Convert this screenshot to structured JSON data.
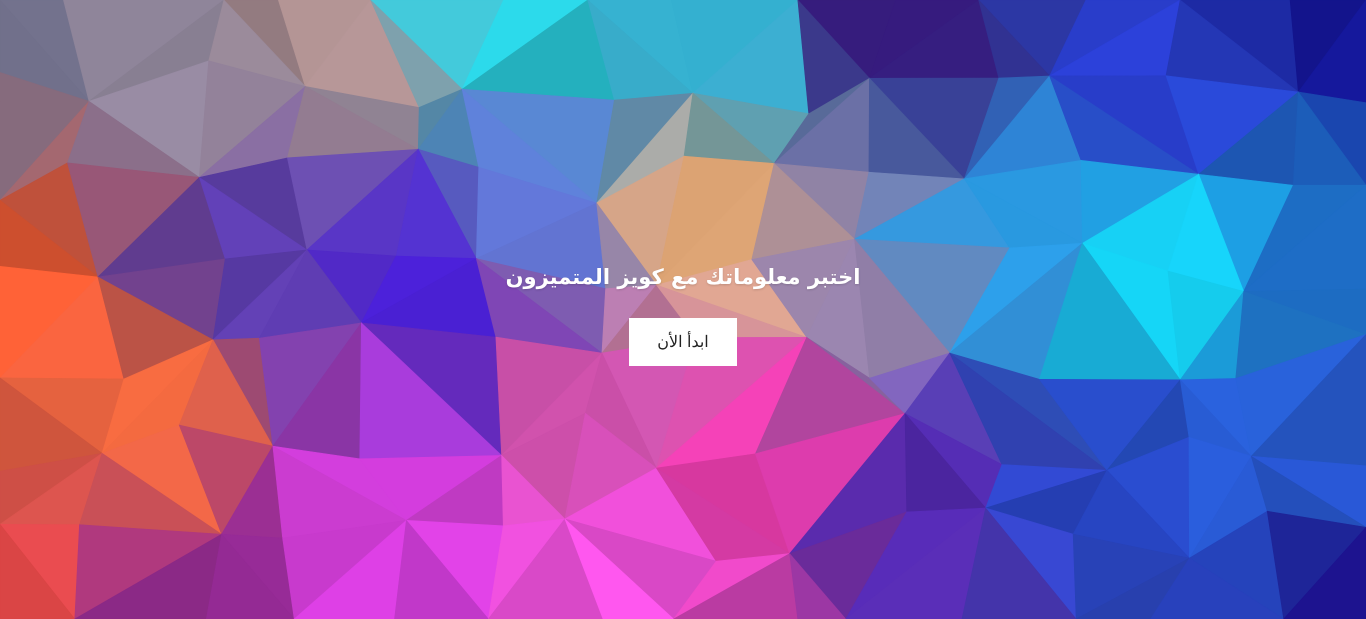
{
  "background": {
    "description_icon": "low-poly-gradient-background"
  },
  "hero": {
    "title": "اختبر معلوماتك مع كويز المتميزون",
    "start_button_label": "ابدأ الأن"
  },
  "colors": {
    "title_text": "#ffffff",
    "button_bg": "#ffffff",
    "button_text": "#222222"
  }
}
